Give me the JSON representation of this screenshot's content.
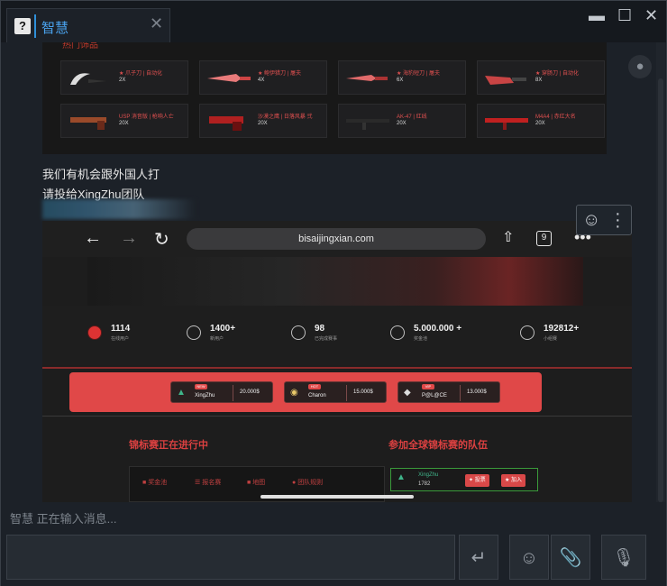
{
  "window": {
    "tab_title": "智慧",
    "help_glyph": "?",
    "close_tab_glyph": "✕",
    "minimize_glyph": "▬",
    "maximize_glyph": "☐",
    "close_glyph": "✕"
  },
  "market": {
    "header": "热门饰品",
    "items": [
      {
        "name": "★ 爪子刀 | 自动化",
        "price": "2X"
      },
      {
        "name": "★ 鲍伊猎刀 | 屠夫",
        "price": "4X"
      },
      {
        "name": "★ 海豹短刀 | 屠夫",
        "price": "6X"
      },
      {
        "name": "★ 穿肠刀 | 自动化",
        "price": "8X"
      },
      {
        "name": "USP 消音版 | 枪响人亡",
        "price": "20X"
      },
      {
        "name": "沙漠之鹰 | 日落风暴 弐",
        "price": "20X"
      },
      {
        "name": "AK-47 | 红线",
        "price": "20X"
      },
      {
        "name": "M4A4 | 赤红大名",
        "price": "20X"
      }
    ]
  },
  "message": {
    "line1": "我们有机会跟外国人打",
    "line2": "请投给XingZhu团队"
  },
  "phone": {
    "url": "bisaijingxian.com",
    "tab_count": "9",
    "stats": [
      {
        "value": "1114",
        "label": "在线用户"
      },
      {
        "value": "1400+",
        "label": "新用户"
      },
      {
        "value": "98",
        "label": "已完成赛事"
      },
      {
        "value": "5.000.000 +",
        "label": "奖金池"
      },
      {
        "value": "192812+",
        "label": "小组赛"
      }
    ],
    "teams": [
      {
        "badge": "NEW",
        "name": "XingZhu",
        "price": "20.000$"
      },
      {
        "badge": "HOT",
        "name": "Charon",
        "price": "15.000$"
      },
      {
        "badge": "VIP",
        "name": "P@L@CE",
        "price": "13.000$"
      }
    ],
    "section_left": "锦标赛正在进行中",
    "section_right": "参加全球锦标赛的队伍",
    "panel_tabs": [
      "奖金池",
      "报名赛",
      "地图",
      "团队规则"
    ],
    "team_row": {
      "name": "XingZhu",
      "score": "1782",
      "vote_label": "投票",
      "join_label": "加入"
    }
  },
  "status": {
    "typing": "智慧 正在输入消息..."
  },
  "input": {
    "placeholder": ""
  },
  "icons": {
    "send": "send-icon",
    "emoji": "emoji-icon",
    "attach": "paperclip-icon",
    "mic": "mic-icon"
  }
}
